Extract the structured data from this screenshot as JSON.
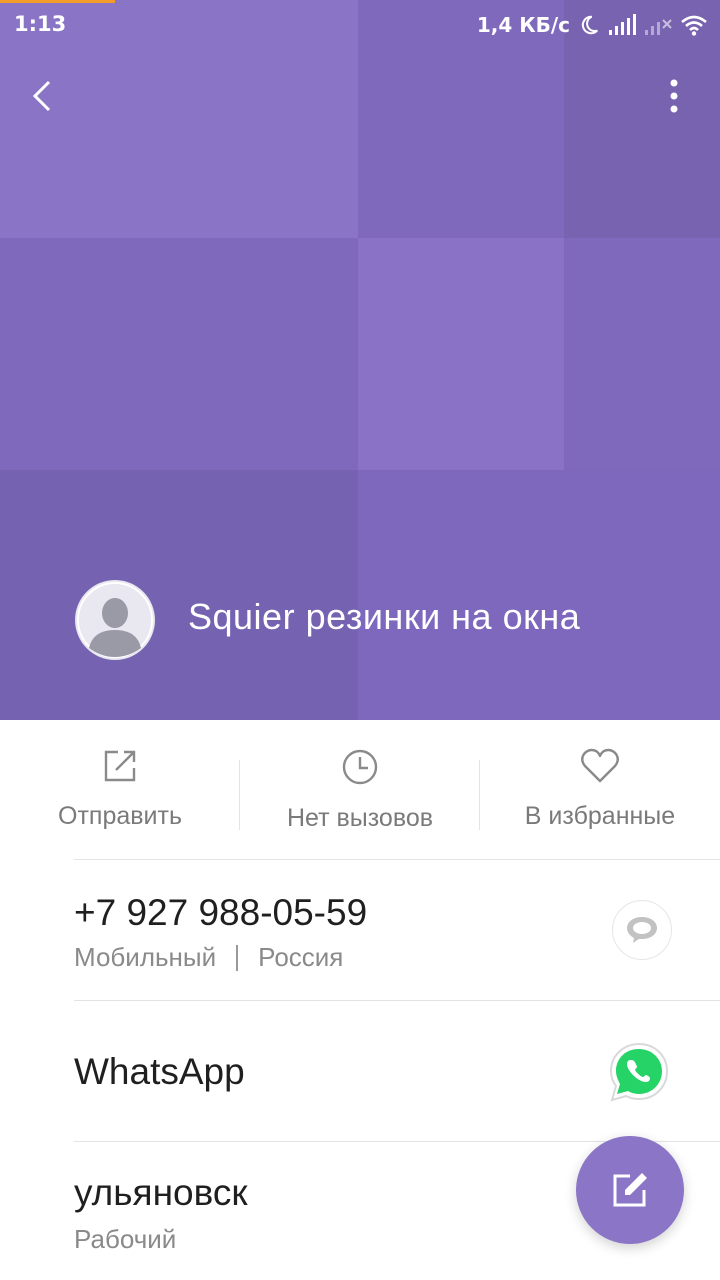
{
  "status_bar": {
    "time": "1:13",
    "net_speed": "1,4 КБ/с",
    "icons": [
      "moon-icon",
      "signal-icon",
      "signal-off-icon",
      "wifi-icon"
    ]
  },
  "colors": {
    "header": "#7e68bd",
    "accent_orange": "#f39c2b",
    "fab": "#8a75c6",
    "whatsapp_green": "#25d366"
  },
  "contact": {
    "name": "Squier резинки на окна"
  },
  "actions": [
    {
      "label": "Отправить",
      "icon": "share-icon"
    },
    {
      "label": "Нет вызовов",
      "icon": "clock-icon"
    },
    {
      "label": "В избранные",
      "icon": "heart-icon"
    }
  ],
  "phone": {
    "number": "+7 927 988-05-59",
    "type": "Мобильный",
    "region": "Россия"
  },
  "whatsapp": {
    "label": "WhatsApp"
  },
  "address": {
    "value": "ульяновск",
    "type": "Рабочий"
  }
}
